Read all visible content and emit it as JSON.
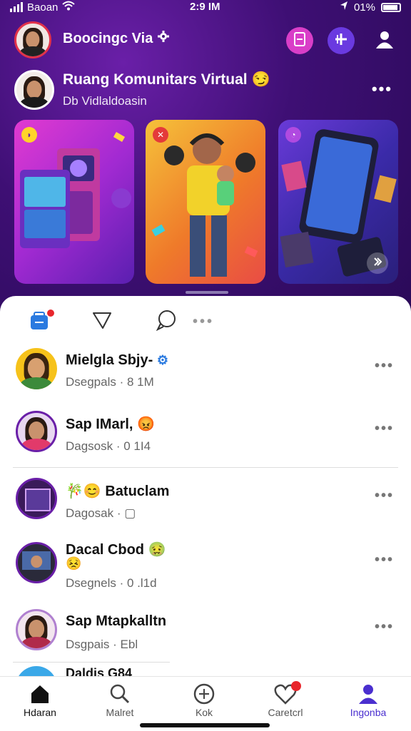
{
  "status": {
    "carrier": "Baoan",
    "time": "2:9 IM",
    "battery": "01%"
  },
  "header": {
    "title": "Boocingc Via"
  },
  "community": {
    "title": "Ruang Komunitars Virtual",
    "emoji": "😏",
    "subtitle": "Db Vidlaldoasin",
    "more": "•••"
  },
  "feed_tabs": {
    "more": "•••"
  },
  "chats": [
    {
      "name": "Mielgla Sbjy-",
      "badge": "⚙",
      "meta": "Dsegpals · 8 1M",
      "more": "•••"
    },
    {
      "name": "Sap IMarl,",
      "emoji": "😡",
      "meta": "Dagsosk · 0 1I4",
      "more": "•••"
    },
    {
      "name": "🎋😊 Batuclam",
      "meta": "Dagosak · ▢",
      "more": "•••"
    },
    {
      "name": "Dacal Cbod",
      "emoji": "🤢",
      "emoji2": "😣",
      "meta": "Dsegnels · 0 .l1d",
      "more": "•••"
    },
    {
      "name": "Sap Mtapkalltn",
      "meta": "Dsgpais · Ebl",
      "more": "•••"
    },
    {
      "name": "Daldis G84"
    }
  ],
  "tabbar": [
    {
      "label": "Hdaran"
    },
    {
      "label": "Malret"
    },
    {
      "label": "Kok"
    },
    {
      "label": "Caretcrl"
    },
    {
      "label": "Ingonba"
    }
  ],
  "colors": {
    "accent": "#5b2bd6",
    "header_bg": "#3e0f74",
    "active_tab": "#4a2fcf",
    "notification": "#e8262c"
  }
}
